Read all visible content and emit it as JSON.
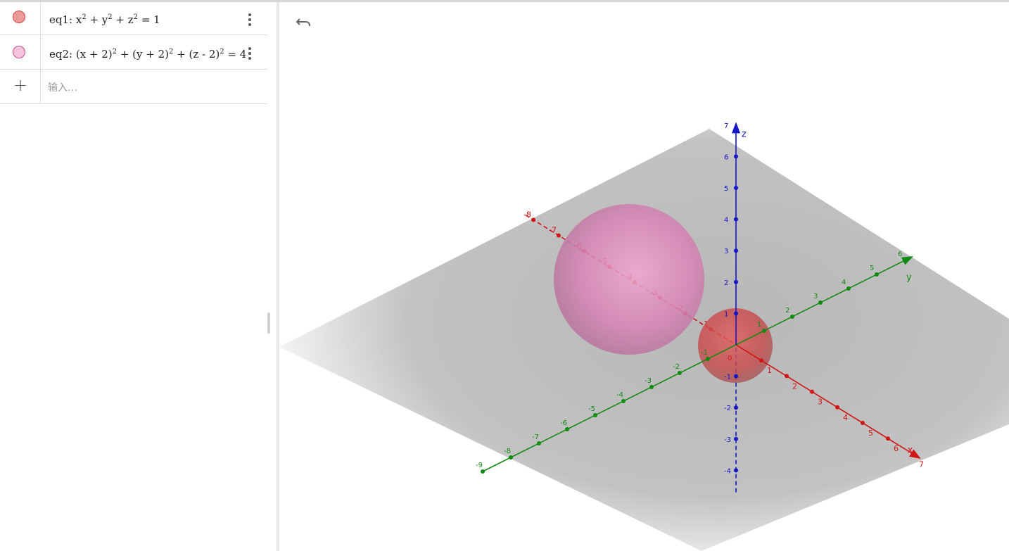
{
  "algebra": {
    "items": [
      {
        "name": "eq1",
        "label": "eq1:",
        "color": "#e07a7a",
        "border": "#b94a4a"
      },
      {
        "name": "eq2",
        "label": "eq2:",
        "color": "#f2bcd9",
        "border": "#c2507f"
      }
    ],
    "input_placeholder": "输入…"
  },
  "graphics": {
    "undo_icon": "undo-icon",
    "axes": {
      "x": {
        "label": "x",
        "color": "#d11515"
      },
      "y": {
        "label": "y",
        "color": "#138a13"
      },
      "z": {
        "label": "z",
        "color": "#1515c8"
      }
    },
    "x_ticks": [
      "-8",
      "-7",
      "-6",
      "-5",
      "-4",
      "-3",
      "-2",
      "-1",
      "1",
      "2",
      "3",
      "4",
      "5",
      "6",
      "7"
    ],
    "y_ticks": [
      "-9",
      "-8",
      "-7",
      "-6",
      "-5",
      "-4",
      "-3",
      "-2",
      "-1",
      "1",
      "2",
      "3",
      "4",
      "5",
      "6"
    ],
    "z_ticks": [
      "-4",
      "-3",
      "-2",
      "-1",
      "1",
      "2",
      "3",
      "4",
      "5",
      "6",
      "7"
    ],
    "origin_label": "0",
    "spheres": [
      {
        "name": "eq1",
        "color": "#d33"
      },
      {
        "name": "eq2",
        "color": "#d36aa3"
      }
    ]
  }
}
